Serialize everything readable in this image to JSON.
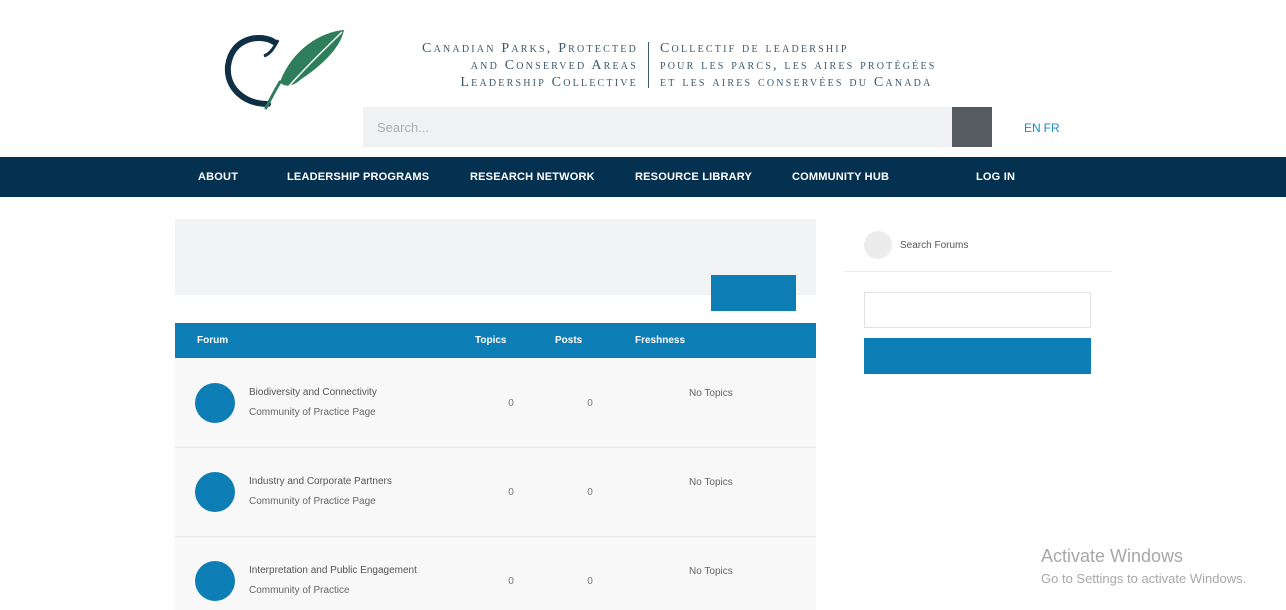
{
  "header": {
    "brand_en": [
      "Canadian Parks, Protected",
      "and Conserved Areas",
      "Leadership Collective"
    ],
    "brand_fr": [
      "Collectif de leadership",
      "pour les parcs, les aires protégées",
      "et les aires conservées du Canada"
    ],
    "search_placeholder": "Search...",
    "lang_en": "EN",
    "lang_fr": "FR"
  },
  "nav": {
    "items": [
      "ABOUT",
      "LEADERSHIP PROGRAMS",
      "RESEARCH NETWORK",
      "RESOURCE LIBRARY",
      "COMMUNITY HUB",
      "LOG IN"
    ]
  },
  "forum_table": {
    "headers": {
      "forum": "Forum",
      "topics": "Topics",
      "posts": "Posts",
      "freshness": "Freshness"
    },
    "rows": [
      {
        "title": "Biodiversity and Connectivity",
        "subtitle": "Community of Practice Page",
        "topics": "0",
        "posts": "0",
        "freshness": "No Topics"
      },
      {
        "title": "Industry and Corporate Partners",
        "subtitle": "Community of Practice Page",
        "topics": "0",
        "posts": "0",
        "freshness": "No Topics"
      },
      {
        "title": "Interpretation and Public Engagement",
        "subtitle": "Community of Practice",
        "topics": "0",
        "posts": "0",
        "freshness": "No Topics"
      }
    ]
  },
  "sidebar": {
    "title": "Search Forums"
  },
  "watermark": {
    "title": "Activate Windows",
    "subtitle": "Go to Settings to activate Windows."
  },
  "colors": {
    "nav_bg": "#04314f",
    "accent": "#0d7db6",
    "brand_text": "#3d5a6c",
    "leaf": "#2e7d5b",
    "link": "#1a8ccb"
  },
  "icons": {
    "logo": "feather-c-logo",
    "search_button": "search-icon",
    "sidebar": "search-forums-icon"
  }
}
